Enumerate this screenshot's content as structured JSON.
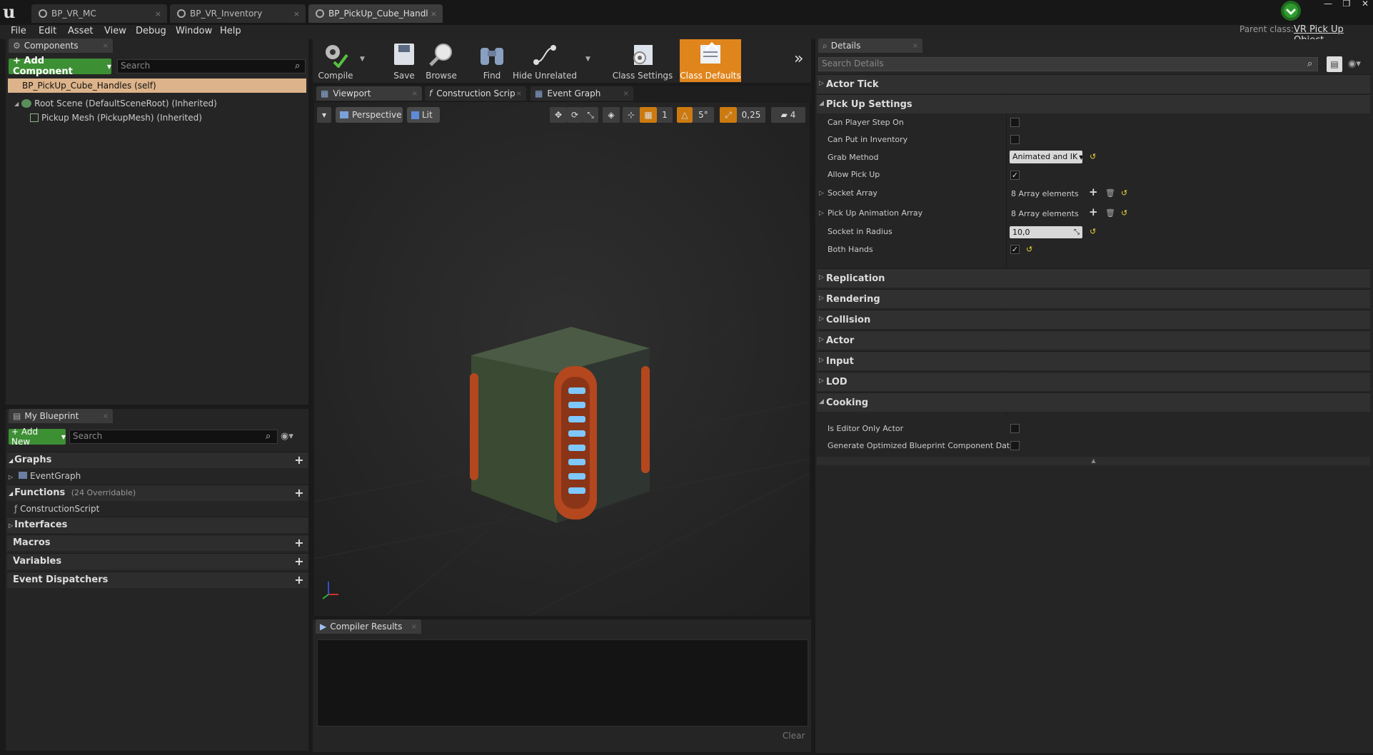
{
  "tabs": [
    {
      "label": "BP_VR_MC",
      "active": false
    },
    {
      "label": "BP_VR_Inventory",
      "active": false
    },
    {
      "label": "BP_PickUp_Cube_Handles",
      "active": true
    }
  ],
  "menu": [
    "File",
    "Edit",
    "Asset",
    "View",
    "Debug",
    "Window",
    "Help"
  ],
  "parent_class": {
    "label": "Parent class:",
    "value": "VR Pick Up Object"
  },
  "components": {
    "tab": "Components",
    "add_button": "+ Add Component",
    "search_placeholder": "Search",
    "self_item": "BP_PickUp_Cube_Handles (self)",
    "tree": [
      {
        "label": "Root Scene (DefaultSceneRoot) (Inherited)"
      },
      {
        "label": "Pickup Mesh (PickupMesh) (Inherited)"
      }
    ]
  },
  "my_blueprint": {
    "tab": "My Blueprint",
    "add_button": "+ Add New",
    "search_placeholder": "Search",
    "graphs": "Graphs",
    "event_graph": "EventGraph",
    "functions": "Functions",
    "functions_count": "(24 Overridable)",
    "construction_script": "ConstructionScript",
    "interfaces": "Interfaces",
    "macros": "Macros",
    "variables": "Variables",
    "event_dispatchers": "Event Dispatchers"
  },
  "toolbar": {
    "compile": "Compile",
    "save": "Save",
    "browse": "Browse",
    "find": "Find",
    "hide_unrelated": "Hide Unrelated",
    "class_settings": "Class Settings",
    "class_defaults": "Class Defaults"
  },
  "editor_tabs": {
    "viewport": "Viewport",
    "construction": "Construction Scrip",
    "event_graph": "Event Graph"
  },
  "viewport_bar": {
    "perspective": "Perspective",
    "lit": "Lit",
    "layer": "1",
    "angle": "5°",
    "scale": "0,25",
    "speed": "4"
  },
  "compiler": {
    "tab": "Compiler Results",
    "clear": "Clear"
  },
  "details": {
    "tab": "Details",
    "search_placeholder": "Search Details",
    "actor_tick": "Actor Tick",
    "pickup_settings": "Pick Up Settings",
    "can_player_step_on": "Can Player Step On",
    "can_put_in_inventory": "Can Put in Inventory",
    "grab_method": "Grab Method",
    "grab_method_value": "Animated and IK",
    "allow_pick_up": "Allow Pick Up",
    "socket_array": "Socket Array",
    "socket_array_value": "8 Array elements",
    "pickup_anim_array": "Pick Up Animation Array",
    "pickup_anim_array_value": "8 Array elements",
    "socket_in_radius": "Socket in Radius",
    "socket_in_radius_value": "10,0",
    "both_hands": "Both Hands",
    "replication": "Replication",
    "rendering": "Rendering",
    "collision": "Collision",
    "actor": "Actor",
    "input": "Input",
    "lod": "LOD",
    "cooking": "Cooking",
    "is_editor_only_actor": "Is Editor Only Actor",
    "generate_optimized": "Generate Optimized Blueprint Component Data",
    "checkboxes": {
      "can_player_step_on": false,
      "can_put_in_inventory": false,
      "allow_pick_up": true,
      "both_hands": true,
      "is_editor_only_actor": false,
      "generate_optimized": false
    }
  },
  "colors": {
    "accent_orange": "#e0851c",
    "green_button": "#3d8f34",
    "self_highlight": "#dcb38a",
    "reset_yellow": "#e8d23c"
  }
}
